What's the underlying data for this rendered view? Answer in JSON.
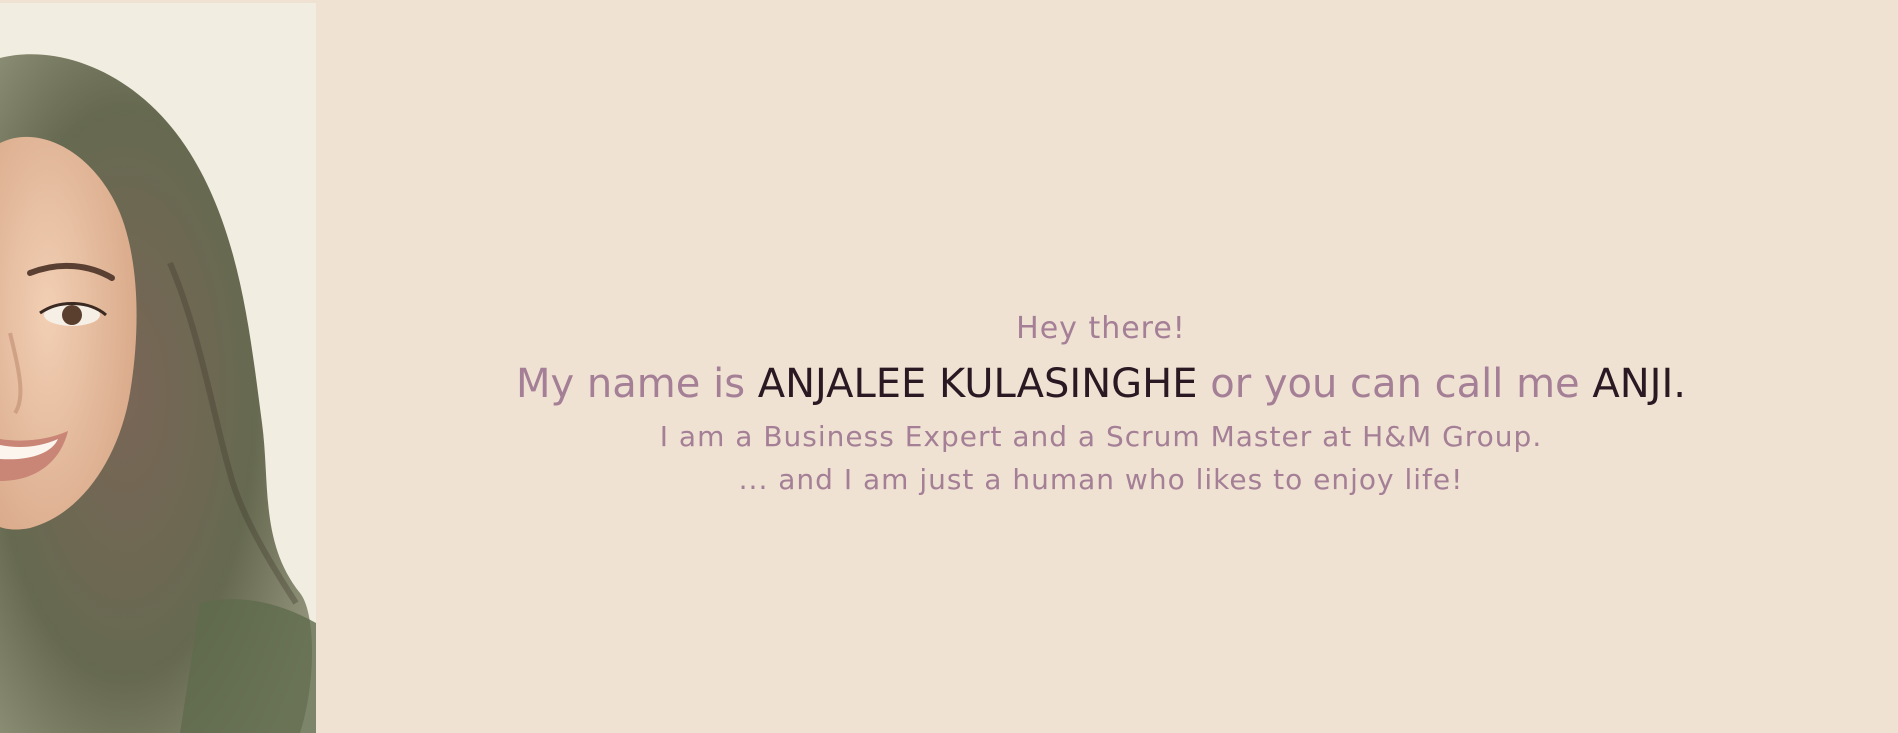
{
  "colors": {
    "background": "#efe2d3",
    "accent_text": "#a47f96",
    "strong_text": "#2a1822"
  },
  "portrait": {
    "icon": "watercolor-portrait"
  },
  "intro": {
    "greeting": "Hey there!",
    "name_prefix": "My name is ",
    "full_name": "ANJALEE KULASINGHE",
    "name_middle": " or you can call me ",
    "nickname": "ANJI.",
    "role": "I am a Business Expert and a Scrum Master at H&M Group.",
    "tagline": "... and I am just a human who likes to enjoy life!"
  }
}
